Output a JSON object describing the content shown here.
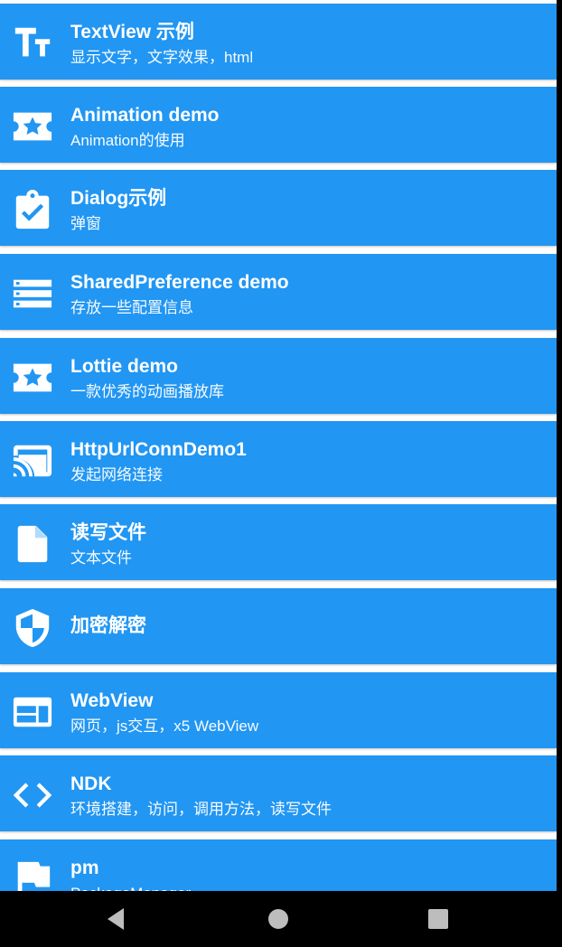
{
  "items": [
    {
      "title": "TextView 示例",
      "subtitle": "显示文字，文字效果，html",
      "icon": "text-fields-icon"
    },
    {
      "title": "Animation demo",
      "subtitle": "Animation的使用",
      "icon": "ticket-star-icon"
    },
    {
      "title": "Dialog示例",
      "subtitle": "弹窗",
      "icon": "clipboard-check-icon"
    },
    {
      "title": "SharedPreference demo",
      "subtitle": "存放一些配置信息",
      "icon": "storage-icon"
    },
    {
      "title": "Lottie demo",
      "subtitle": "一款优秀的动画播放库",
      "icon": "ticket-star-icon"
    },
    {
      "title": "HttpUrlConnDemo1",
      "subtitle": "发起网络连接",
      "icon": "cast-icon"
    },
    {
      "title": "读写文件",
      "subtitle": "文本文件",
      "icon": "file-icon"
    },
    {
      "title": "加密解密",
      "subtitle": "",
      "icon": "security-shield-icon"
    },
    {
      "title": "WebView",
      "subtitle": "网页，js交互，x5 WebView",
      "icon": "web-icon"
    },
    {
      "title": "NDK",
      "subtitle": "环境搭建，访问，调用方法，读写文件",
      "icon": "code-icon"
    },
    {
      "title": "pm",
      "subtitle": "PackageManager",
      "icon": "flag-icon"
    }
  ],
  "nav": {
    "back": "back-icon",
    "home": "home-icon",
    "recents": "recents-icon"
  },
  "colors": {
    "card": "#2196F3",
    "text": "#FFFFFF",
    "navbar": "#000000"
  }
}
